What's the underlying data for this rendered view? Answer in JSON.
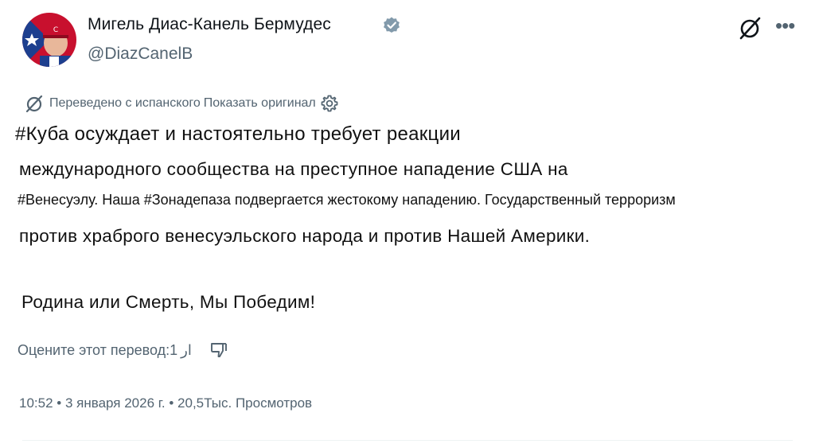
{
  "author": {
    "display_name": "Мигель Диас-Канель Бермудес",
    "handle": "@DiazCanelB",
    "verified_icon": "verified-badge-icon",
    "avatar_colors": [
      "#c8102e",
      "#1d3f8f",
      "#ffffff"
    ]
  },
  "header_actions": {
    "grok_icon": "slashed-circle-icon",
    "more_label": "•••"
  },
  "translation": {
    "notice": "Переведено с испанского",
    "show_original": "Показать оригинал",
    "settings_icon": "gear-icon"
  },
  "post": {
    "lines": [
      "#Куба осуждает и настоятельно требует реакции",
      "международного сообщества на преступное нападение США на",
      "#Венесуэлу. Наша #Зонадепаза подвергается жестокому нападению. Государственный терроризм",
      "против храброго венесуэльского народа и против Нашей Америки.",
      "Родина или Смерть, Мы Победим!"
    ]
  },
  "rating": {
    "label": "Оцените этот перевод:",
    "thumb_up_count": "1",
    "thumb_up_glyph": "ار",
    "thumb_down_icon": "thumbs-down-icon"
  },
  "meta": {
    "time": "10:52",
    "date": "3 января 2026 г.",
    "views": "20,5Тыс.",
    "views_label": "Просмотров",
    "separator": "•"
  },
  "colors": {
    "text": "#0f1419",
    "muted": "#536471",
    "verified": "#829aab"
  }
}
